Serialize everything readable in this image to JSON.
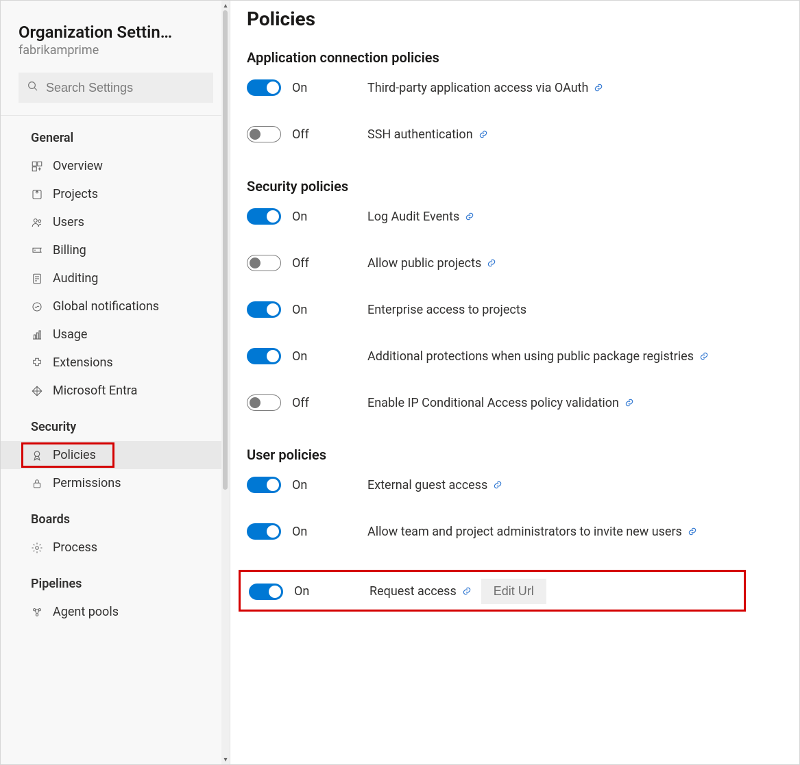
{
  "sidebar": {
    "title": "Organization Settin…",
    "subtitle": "fabrikamprime",
    "search_placeholder": "Search Settings",
    "groups": [
      {
        "title": "General",
        "items": [
          {
            "label": "Overview",
            "icon": "overview-icon"
          },
          {
            "label": "Projects",
            "icon": "projects-icon"
          },
          {
            "label": "Users",
            "icon": "users-icon"
          },
          {
            "label": "Billing",
            "icon": "billing-icon"
          },
          {
            "label": "Auditing",
            "icon": "auditing-icon"
          },
          {
            "label": "Global notifications",
            "icon": "notifications-icon"
          },
          {
            "label": "Usage",
            "icon": "usage-icon"
          },
          {
            "label": "Extensions",
            "icon": "extensions-icon"
          },
          {
            "label": "Microsoft Entra",
            "icon": "entra-icon"
          }
        ]
      },
      {
        "title": "Security",
        "items": [
          {
            "label": "Policies",
            "icon": "policy-icon",
            "active": true,
            "highlight": true
          },
          {
            "label": "Permissions",
            "icon": "permissions-icon"
          }
        ]
      },
      {
        "title": "Boards",
        "items": [
          {
            "label": "Process",
            "icon": "process-icon"
          }
        ]
      },
      {
        "title": "Pipelines",
        "items": [
          {
            "label": "Agent pools",
            "icon": "agentpools-icon"
          }
        ]
      }
    ]
  },
  "main": {
    "title": "Policies",
    "sections": [
      {
        "title": "Application connection policies",
        "policies": [
          {
            "on": true,
            "state_label": "On",
            "name": "Third-party application access via OAuth",
            "link": true
          },
          {
            "on": false,
            "state_label": "Off",
            "name": "SSH authentication",
            "link": true
          }
        ]
      },
      {
        "title": "Security policies",
        "policies": [
          {
            "on": true,
            "state_label": "On",
            "name": "Log Audit Events",
            "link": true
          },
          {
            "on": false,
            "state_label": "Off",
            "name": "Allow public projects",
            "link": true
          },
          {
            "on": true,
            "state_label": "On",
            "name": "Enterprise access to projects",
            "link": false
          },
          {
            "on": true,
            "state_label": "On",
            "name": "Additional protections when using public package registries",
            "link": true
          },
          {
            "on": false,
            "state_label": "Off",
            "name": "Enable IP Conditional Access policy validation",
            "link": true
          }
        ]
      },
      {
        "title": "User policies",
        "policies": [
          {
            "on": true,
            "state_label": "On",
            "name": "External guest access",
            "link": true
          },
          {
            "on": true,
            "state_label": "On",
            "name": "Allow team and project administrators to invite new users",
            "link": true
          },
          {
            "on": true,
            "state_label": "On",
            "name": "Request access",
            "link": true,
            "edit_label": "Edit Url",
            "highlight": true
          }
        ]
      }
    ]
  }
}
